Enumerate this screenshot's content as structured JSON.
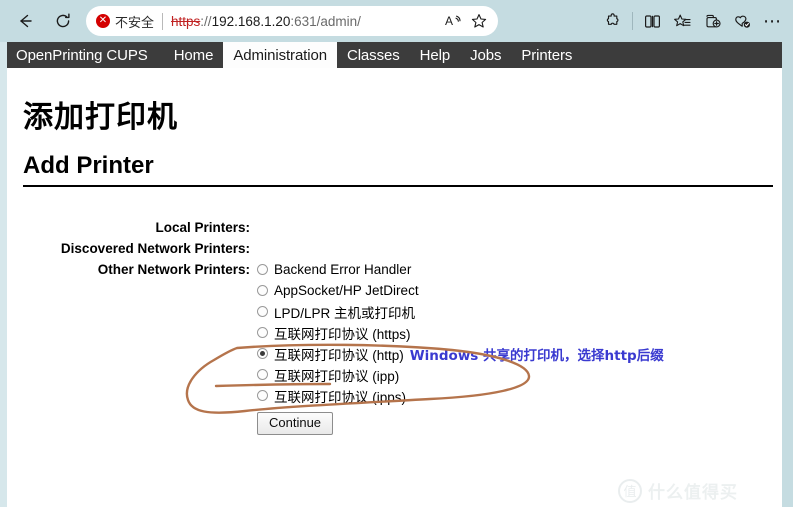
{
  "browser": {
    "back_icon": "back-arrow-icon",
    "reload_icon": "reload-icon",
    "security": {
      "badge_glyph": "✕",
      "label": "不安全"
    },
    "url": {
      "scheme": "https",
      "separator": "://",
      "host": "192.168.1.20",
      "path": ":631/admin/",
      "full": "https://192.168.1.20:631/admin/"
    },
    "pill_icons": [
      {
        "name": "read-aloud-icon",
        "glyph": "A"
      },
      {
        "name": "favorite-star-icon",
        "glyph": "☆"
      }
    ],
    "toolbar_icons": [
      {
        "name": "extensions-icon"
      },
      {
        "name": "split-screen-icon"
      },
      {
        "name": "favorites-list-icon"
      },
      {
        "name": "add-to-collections-icon"
      },
      {
        "name": "browser-essentials-icon"
      },
      {
        "name": "settings-more-icon",
        "glyph": "⋯"
      }
    ]
  },
  "cups_nav": {
    "items": [
      {
        "label": "OpenPrinting CUPS",
        "active": false,
        "brand": true
      },
      {
        "label": "Home",
        "active": false,
        "brand": false
      },
      {
        "label": "Administration",
        "active": true,
        "brand": false
      },
      {
        "label": "Classes",
        "active": false,
        "brand": false
      },
      {
        "label": "Help",
        "active": false,
        "brand": false
      },
      {
        "label": "Jobs",
        "active": false,
        "brand": false
      },
      {
        "label": "Printers",
        "active": false,
        "brand": false
      }
    ]
  },
  "page": {
    "heading_cn": "添加打印机",
    "heading_en": "Add Printer"
  },
  "form": {
    "rows": [
      {
        "label": "Local Printers:",
        "options": []
      },
      {
        "label": "Discovered Network Printers:",
        "options": []
      },
      {
        "label": "Other Network Printers:",
        "options": [
          {
            "text": "Backend Error Handler",
            "checked": false,
            "annotation": ""
          },
          {
            "text": "AppSocket/HP JetDirect",
            "checked": false,
            "annotation": ""
          },
          {
            "text": "LPD/LPR 主机或打印机",
            "checked": false,
            "annotation": ""
          },
          {
            "text": "互联网打印协议 (https)",
            "checked": false,
            "annotation": ""
          },
          {
            "text": "互联网打印协议 (http)",
            "checked": true,
            "annotation": "Windows 共享的打印机，选择http后缀"
          },
          {
            "text": "互联网打印协议 (ipp)",
            "checked": false,
            "annotation": ""
          },
          {
            "text": "互联网打印协议 (ipps)",
            "checked": false,
            "annotation": ""
          }
        ]
      }
    ],
    "continue_label": "Continue"
  },
  "annotation": {
    "ellipse_color": "#b5744c",
    "text_color": "#3a3ad0"
  },
  "watermark": {
    "mark_glyph": "值",
    "text": "什么值得买"
  }
}
